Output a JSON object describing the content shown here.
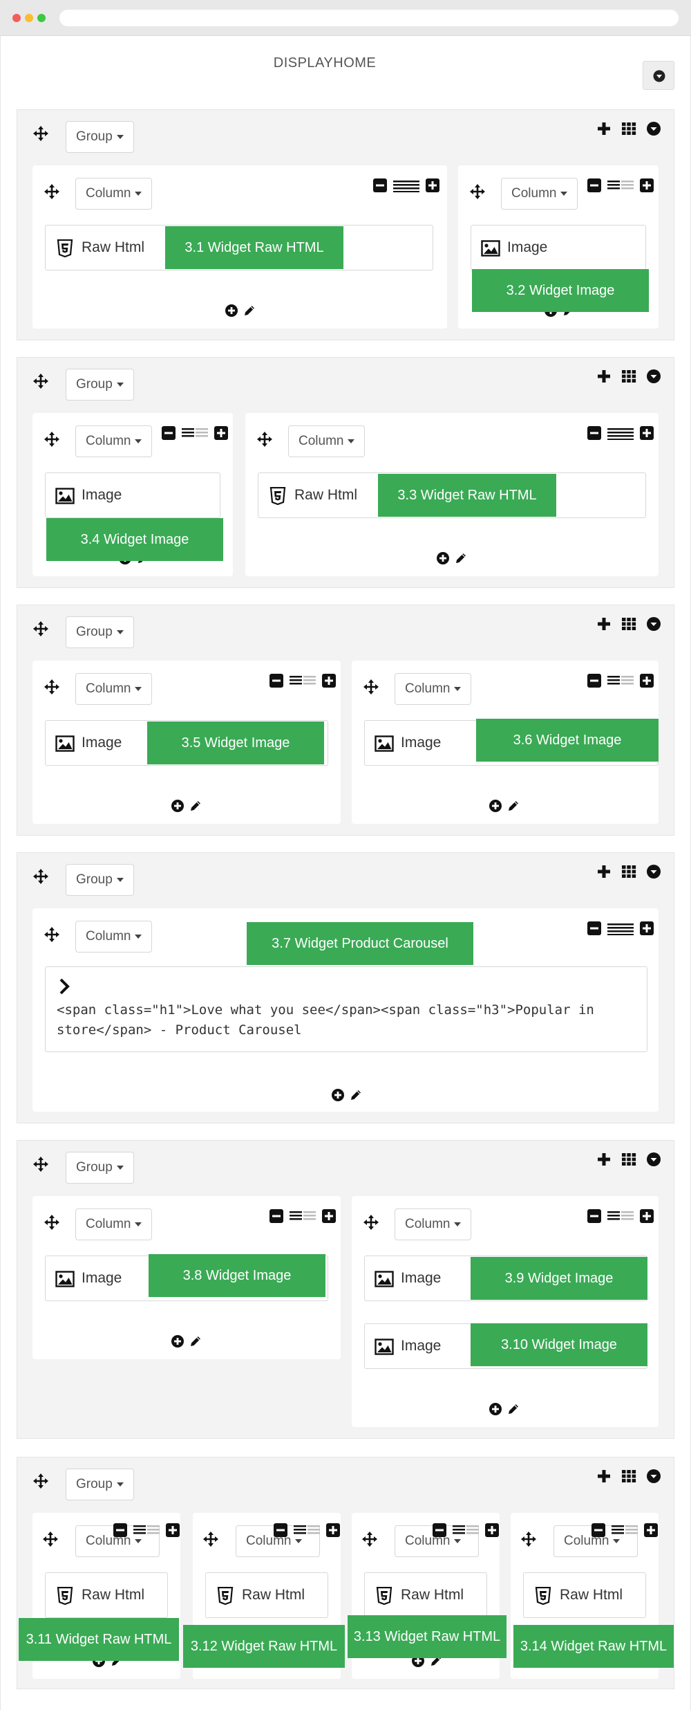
{
  "page": {
    "title": "DISPLAYHOME"
  },
  "labels": {
    "group": "Group",
    "column": "Column",
    "raw_html": "Raw Html",
    "image": "Image"
  },
  "groups": [
    {
      "columns": [
        {
          "widgets": [
            {
              "type": "raw_html",
              "badge": "3.1 Widget Raw HTML"
            }
          ]
        },
        {
          "widgets": [
            {
              "type": "image",
              "badge": "3.2 Widget Image"
            }
          ]
        }
      ]
    },
    {
      "columns": [
        {
          "widgets": [
            {
              "type": "image",
              "badge": "3.4 Widget Image"
            }
          ]
        },
        {
          "widgets": [
            {
              "type": "raw_html",
              "badge": "3.3 Widget Raw HTML"
            }
          ]
        }
      ]
    },
    {
      "columns": [
        {
          "widgets": [
            {
              "type": "image",
              "badge": "3.5 Widget Image"
            }
          ]
        },
        {
          "widgets": [
            {
              "type": "image",
              "badge": "3.6 Widget Image"
            }
          ]
        }
      ]
    },
    {
      "columns": [
        {
          "badge": "3.7 Widget Product Carousel",
          "widgets": [
            {
              "type": "product_carousel",
              "text": "<span class=\"h1\">Love what you see</span><span class=\"h3\">Popular in store</span> - Product Carousel"
            }
          ]
        }
      ]
    },
    {
      "columns": [
        {
          "widgets": [
            {
              "type": "image",
              "badge": "3.8 Widget Image"
            }
          ]
        },
        {
          "widgets": [
            {
              "type": "image",
              "badge": "3.9 Widget Image"
            },
            {
              "type": "image",
              "badge": "3.10 Widget Image"
            }
          ]
        }
      ]
    },
    {
      "columns": [
        {
          "widgets": [
            {
              "type": "raw_html",
              "badge": "3.11 Widget Raw HTML"
            }
          ]
        },
        {
          "widgets": [
            {
              "type": "raw_html",
              "badge": "3.12 Widget Raw HTML"
            }
          ]
        },
        {
          "widgets": [
            {
              "type": "raw_html",
              "badge": "3.13 Widget Raw HTML"
            }
          ]
        },
        {
          "widgets": [
            {
              "type": "raw_html",
              "badge": "3.14 Widget Raw HTML"
            }
          ]
        }
      ]
    }
  ],
  "icons": {
    "move": "move-arrows-icon",
    "add": "plus-icon",
    "grid": "grid-icon",
    "toggle": "circle-arrow-down-icon",
    "shrink": "minus-square-icon",
    "width": "lines-icon",
    "expand": "plus-square-icon",
    "add_widget": "circle-plus-icon",
    "edit": "pencil-icon",
    "html5": "html5-icon",
    "image": "image-icon",
    "chevron": "chevron-right-icon"
  },
  "colors": {
    "green": "#3aaa55",
    "group_bg": "#f3f3f3",
    "column_bg": "#ffffff"
  }
}
